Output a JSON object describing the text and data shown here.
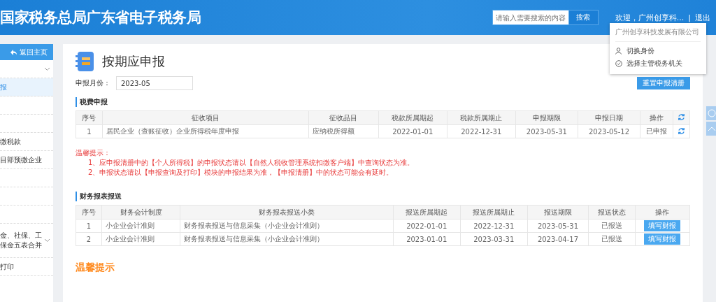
{
  "header": {
    "title": "国家税务总局广东省电子税务局",
    "search": {
      "placeholder": "请输入需要搜索的内容",
      "button": "搜索"
    },
    "welcome": "欢迎，广州创享科...",
    "separator": "|",
    "logout": "退出"
  },
  "user_menu": {
    "company": "广州创享科技发展有限公司",
    "items": [
      {
        "kind": "user",
        "label": "切换身份"
      },
      {
        "kind": "check",
        "label": "选择主管税务机关"
      }
    ]
  },
  "sidebar": {
    "back": "返回主页",
    "items": [
      {
        "expandable": true,
        "selected": false
      },
      {
        "label": "报",
        "expandable": false,
        "selected": true
      },
      {
        "expandable": false,
        "selected": false
      },
      {
        "expandable": false,
        "selected": false
      },
      {
        "label": "缴税款",
        "expandable": false,
        "selected": false
      },
      {
        "label": "目部预缴企业",
        "expandable": false,
        "selected": false
      },
      {
        "expandable": false,
        "selected": false
      },
      {
        "expandable": false,
        "selected": false
      },
      {
        "expandable": false,
        "selected": false
      },
      {
        "label": "金、社保、工保金五表合并",
        "expandable": true,
        "selected": false
      },
      {
        "label": "打印",
        "expandable": false,
        "selected": false
      }
    ]
  },
  "page": {
    "title": "按期应申报",
    "month_label": "申报月份：",
    "month_value": "2023-05",
    "reset_button": "重置申报清册"
  },
  "tax_section": {
    "title": "税费申报",
    "columns": [
      "序号",
      "征收项目",
      "征收品目",
      "税款所属期起",
      "税款所属期止",
      "申报期限",
      "申报日期",
      "操作"
    ],
    "rows": [
      {
        "cells": [
          "1",
          "居民企业（查账征收）企业所得税年度申报",
          "应纳税所得额",
          "2022-01-01",
          "2022-12-31",
          "2023-05-31",
          "2023-05-12",
          "已申报"
        ]
      }
    ]
  },
  "notice": {
    "title": "温馨提示：",
    "lines": [
      "1、应申报清册中的【个人所得税】的申报状态请以【自然人税收管理系统扣缴客户端】中查询状态为准。",
      "2、申报状态请以【申报查询及打印】模块的申报结果为准，【申报清册】中的状态可能会有延时。"
    ]
  },
  "report_section": {
    "title": "财务报表报送",
    "columns": [
      "序号",
      "财务会计制度",
      "财务报表报送小类",
      "报送所属期起",
      "报送所属期止",
      "报送期限",
      "报送状态",
      "操作"
    ],
    "rows": [
      {
        "cells": [
          "1",
          "小企业会计准则",
          "财务报表报送与信息采集（小企业会计准则）",
          "2022-01-01",
          "2022-12-31",
          "2023-05-31",
          "已报送"
        ],
        "action": "填写财报"
      },
      {
        "cells": [
          "2",
          "小企业会计准则",
          "财务报表报送与信息采集（小企业会计准则）",
          "2023-01-01",
          "2023-03-31",
          "2023-04-17",
          "已报送"
        ],
        "action": "填写财报"
      }
    ]
  },
  "tips": {
    "title": "温馨提示"
  }
}
